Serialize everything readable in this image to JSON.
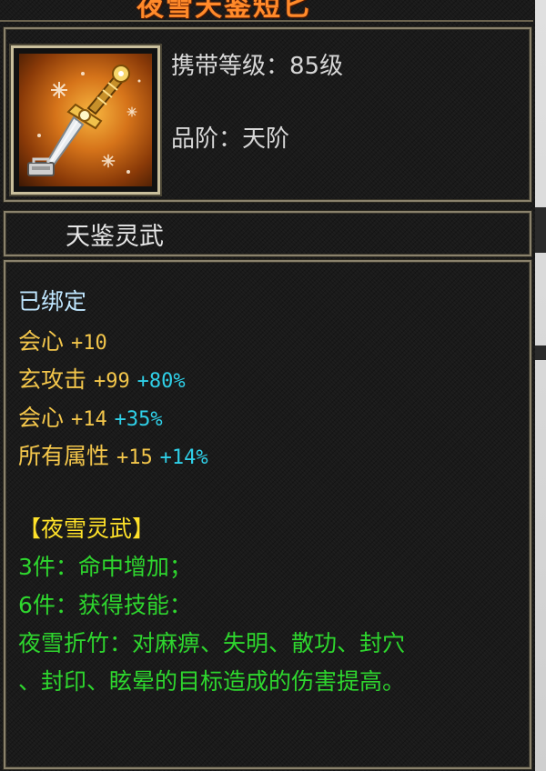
{
  "item": {
    "name": "夜雪天鉴短匕",
    "carry_level": "携带等级：85级",
    "quality": "品阶：天阶",
    "series": "天鉴灵武"
  },
  "attributes": {
    "bound": "已绑定",
    "stats": [
      {
        "name": "会心",
        "value": "+10",
        "percent": ""
      },
      {
        "name": "玄攻击",
        "value": "+99",
        "percent": "+80%"
      },
      {
        "name": "会心",
        "value": "+14",
        "percent": "+35%"
      },
      {
        "name": "所有属性",
        "value": "+15",
        "percent": "+14%"
      }
    ]
  },
  "set_bonus": {
    "title": "【夜雪灵武】",
    "lines": [
      "3件：命中增加；",
      "6件：获得技能：",
      "夜雪折竹：对麻痹、失明、散功、封穴",
      "、封印、眩晕的目标造成的伤害提高。"
    ]
  },
  "colors": {
    "title": "#ff8a2a",
    "stat": "#f3c64b",
    "percent": "#2fd0e8",
    "set_title": "#ffe22a",
    "set_text": "#2ed62e",
    "bound": "#bfe6ff",
    "border": "#8a826c"
  },
  "icons": [
    "dagger-icon",
    "lock-icon",
    "snowflake-icon"
  ]
}
